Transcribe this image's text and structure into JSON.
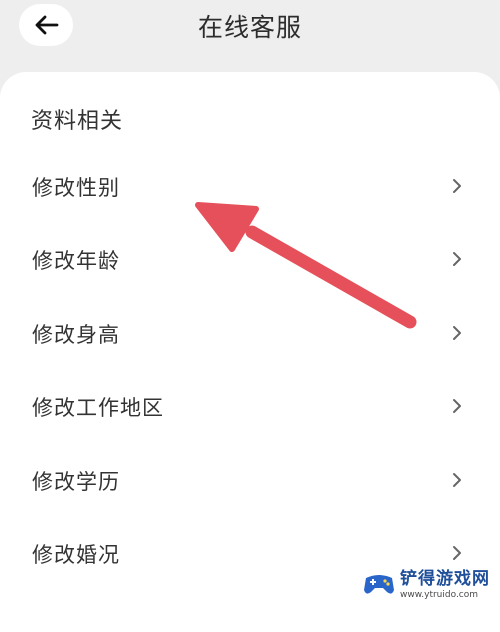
{
  "header": {
    "title": "在线客服",
    "back_icon": "arrow-left-icon"
  },
  "section": {
    "title": "资料相关"
  },
  "menu": {
    "items": [
      {
        "label": "修改性别"
      },
      {
        "label": "修改年龄"
      },
      {
        "label": "修改身高"
      },
      {
        "label": "修改工作地区"
      },
      {
        "label": "修改学历"
      },
      {
        "label": "修改婚况"
      }
    ]
  },
  "annotation": {
    "arrow_color": "#e5505a",
    "icon": "red-pointer-arrow-icon"
  },
  "watermark": {
    "name": "铲得游戏网",
    "url": "www.ytruido.com"
  },
  "colors": {
    "background": "#eeeeee",
    "card": "#ffffff",
    "text": "#333333",
    "chevron": "#666666"
  }
}
